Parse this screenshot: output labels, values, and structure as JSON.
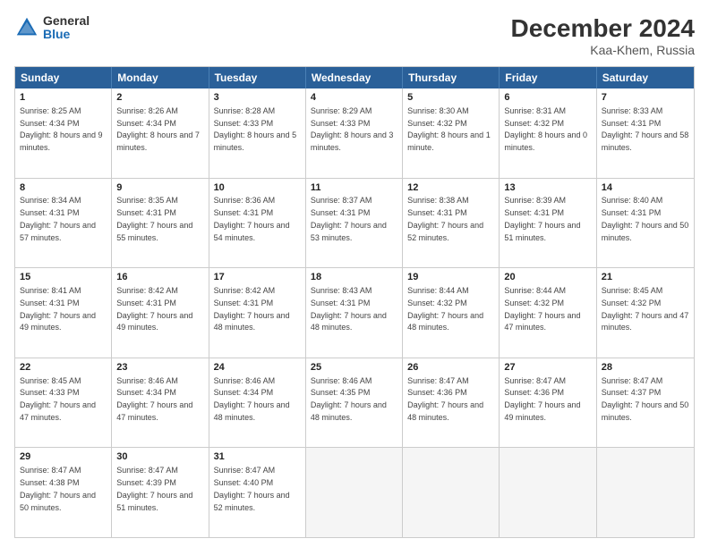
{
  "logo": {
    "general": "General",
    "blue": "Blue"
  },
  "title": "December 2024",
  "subtitle": "Kaa-Khem, Russia",
  "days": [
    "Sunday",
    "Monday",
    "Tuesday",
    "Wednesday",
    "Thursday",
    "Friday",
    "Saturday"
  ],
  "weeks": [
    [
      {
        "day": "1",
        "sunrise": "8:25 AM",
        "sunset": "4:34 PM",
        "daylight": "8 hours and 9 minutes."
      },
      {
        "day": "2",
        "sunrise": "8:26 AM",
        "sunset": "4:34 PM",
        "daylight": "8 hours and 7 minutes."
      },
      {
        "day": "3",
        "sunrise": "8:28 AM",
        "sunset": "4:33 PM",
        "daylight": "8 hours and 5 minutes."
      },
      {
        "day": "4",
        "sunrise": "8:29 AM",
        "sunset": "4:33 PM",
        "daylight": "8 hours and 3 minutes."
      },
      {
        "day": "5",
        "sunrise": "8:30 AM",
        "sunset": "4:32 PM",
        "daylight": "8 hours and 1 minute."
      },
      {
        "day": "6",
        "sunrise": "8:31 AM",
        "sunset": "4:32 PM",
        "daylight": "8 hours and 0 minutes."
      },
      {
        "day": "7",
        "sunrise": "8:33 AM",
        "sunset": "4:31 PM",
        "daylight": "7 hours and 58 minutes."
      }
    ],
    [
      {
        "day": "8",
        "sunrise": "8:34 AM",
        "sunset": "4:31 PM",
        "daylight": "7 hours and 57 minutes."
      },
      {
        "day": "9",
        "sunrise": "8:35 AM",
        "sunset": "4:31 PM",
        "daylight": "7 hours and 55 minutes."
      },
      {
        "day": "10",
        "sunrise": "8:36 AM",
        "sunset": "4:31 PM",
        "daylight": "7 hours and 54 minutes."
      },
      {
        "day": "11",
        "sunrise": "8:37 AM",
        "sunset": "4:31 PM",
        "daylight": "7 hours and 53 minutes."
      },
      {
        "day": "12",
        "sunrise": "8:38 AM",
        "sunset": "4:31 PM",
        "daylight": "7 hours and 52 minutes."
      },
      {
        "day": "13",
        "sunrise": "8:39 AM",
        "sunset": "4:31 PM",
        "daylight": "7 hours and 51 minutes."
      },
      {
        "day": "14",
        "sunrise": "8:40 AM",
        "sunset": "4:31 PM",
        "daylight": "7 hours and 50 minutes."
      }
    ],
    [
      {
        "day": "15",
        "sunrise": "8:41 AM",
        "sunset": "4:31 PM",
        "daylight": "7 hours and 49 minutes."
      },
      {
        "day": "16",
        "sunrise": "8:42 AM",
        "sunset": "4:31 PM",
        "daylight": "7 hours and 49 minutes."
      },
      {
        "day": "17",
        "sunrise": "8:42 AM",
        "sunset": "4:31 PM",
        "daylight": "7 hours and 48 minutes."
      },
      {
        "day": "18",
        "sunrise": "8:43 AM",
        "sunset": "4:31 PM",
        "daylight": "7 hours and 48 minutes."
      },
      {
        "day": "19",
        "sunrise": "8:44 AM",
        "sunset": "4:32 PM",
        "daylight": "7 hours and 48 minutes."
      },
      {
        "day": "20",
        "sunrise": "8:44 AM",
        "sunset": "4:32 PM",
        "daylight": "7 hours and 47 minutes."
      },
      {
        "day": "21",
        "sunrise": "8:45 AM",
        "sunset": "4:32 PM",
        "daylight": "7 hours and 47 minutes."
      }
    ],
    [
      {
        "day": "22",
        "sunrise": "8:45 AM",
        "sunset": "4:33 PM",
        "daylight": "7 hours and 47 minutes."
      },
      {
        "day": "23",
        "sunrise": "8:46 AM",
        "sunset": "4:34 PM",
        "daylight": "7 hours and 47 minutes."
      },
      {
        "day": "24",
        "sunrise": "8:46 AM",
        "sunset": "4:34 PM",
        "daylight": "7 hours and 48 minutes."
      },
      {
        "day": "25",
        "sunrise": "8:46 AM",
        "sunset": "4:35 PM",
        "daylight": "7 hours and 48 minutes."
      },
      {
        "day": "26",
        "sunrise": "8:47 AM",
        "sunset": "4:36 PM",
        "daylight": "7 hours and 48 minutes."
      },
      {
        "day": "27",
        "sunrise": "8:47 AM",
        "sunset": "4:36 PM",
        "daylight": "7 hours and 49 minutes."
      },
      {
        "day": "28",
        "sunrise": "8:47 AM",
        "sunset": "4:37 PM",
        "daylight": "7 hours and 50 minutes."
      }
    ],
    [
      {
        "day": "29",
        "sunrise": "8:47 AM",
        "sunset": "4:38 PM",
        "daylight": "7 hours and 50 minutes."
      },
      {
        "day": "30",
        "sunrise": "8:47 AM",
        "sunset": "4:39 PM",
        "daylight": "7 hours and 51 minutes."
      },
      {
        "day": "31",
        "sunrise": "8:47 AM",
        "sunset": "4:40 PM",
        "daylight": "7 hours and 52 minutes."
      },
      null,
      null,
      null,
      null
    ]
  ]
}
